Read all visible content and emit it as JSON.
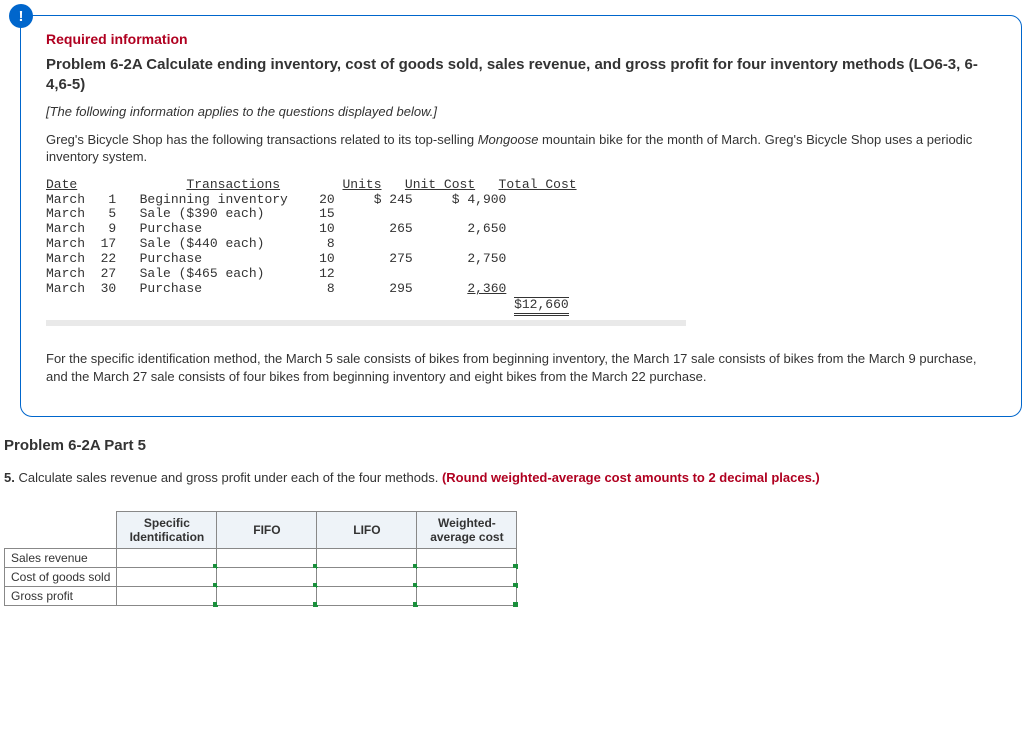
{
  "required_info_label": "Required information",
  "problem_title": "Problem 6-2A Calculate ending inventory, cost of goods sold, sales revenue, and gross profit for four inventory methods (LO6-3, 6-4,6-5)",
  "applies_note": "[The following information applies to the questions displayed below.]",
  "intro_text_1": "Greg's Bicycle Shop has the following transactions related to its top-selling ",
  "intro_text_em": "Mongoose",
  "intro_text_2": " mountain bike for the month of March. Greg's Bicycle Shop uses a periodic inventory system.",
  "trans_table": {
    "headers": {
      "date": "Date",
      "trans": "Transactions",
      "units": "Units",
      "unit_cost": "Unit Cost",
      "total_cost": "Total Cost"
    },
    "rows": [
      {
        "date": "March   1",
        "trans": "Beginning inventory",
        "units": "20",
        "unit_cost": "$ 245",
        "total_cost": "$ 4,900"
      },
      {
        "date": "March   5",
        "trans": "Sale ($390 each)",
        "units": "15",
        "unit_cost": "",
        "total_cost": ""
      },
      {
        "date": "March   9",
        "trans": "Purchase",
        "units": "10",
        "unit_cost": "265",
        "total_cost": "2,650"
      },
      {
        "date": "March  17",
        "trans": "Sale ($440 each)",
        "units": " 8",
        "unit_cost": "",
        "total_cost": ""
      },
      {
        "date": "March  22",
        "trans": "Purchase",
        "units": "10",
        "unit_cost": "275",
        "total_cost": "2,750"
      },
      {
        "date": "March  27",
        "trans": "Sale ($465 each)",
        "units": "12",
        "unit_cost": "",
        "total_cost": ""
      },
      {
        "date": "March  30",
        "trans": "Purchase",
        "units": " 8",
        "unit_cost": "295",
        "total_cost": "2,360"
      }
    ],
    "total": "$12,660"
  },
  "spec_id_note": "For the specific identification method, the March 5 sale consists of bikes from beginning inventory, the March 17 sale consists of bikes from the March 9 purchase, and the March 27 sale consists of four bikes from beginning inventory and eight bikes from the March 22 purchase.",
  "part_title": "Problem 6-2A Part 5",
  "question_num": "5.",
  "question_text": " Calculate sales revenue and gross profit under each of the four methods. ",
  "question_red": "(Round weighted-average cost amounts to 2 decimal places.)",
  "answer_grid": {
    "columns": [
      "Specific Identification",
      "FIFO",
      "LIFO",
      "Weighted-average cost"
    ],
    "rows": [
      "Sales revenue",
      "Cost of goods sold",
      "Gross profit"
    ]
  },
  "chart_data": {
    "type": "table",
    "title": "March transactions — Mongoose mountain bike (periodic inventory)",
    "columns": [
      "Date",
      "Transactions",
      "Units",
      "Unit Cost",
      "Total Cost"
    ],
    "rows": [
      [
        "March 1",
        "Beginning inventory",
        20,
        245,
        4900
      ],
      [
        "March 5",
        "Sale ($390 each)",
        15,
        null,
        null
      ],
      [
        "March 9",
        "Purchase",
        10,
        265,
        2650
      ],
      [
        "March 17",
        "Sale ($440 each)",
        8,
        null,
        null
      ],
      [
        "March 22",
        "Purchase",
        10,
        275,
        2750
      ],
      [
        "March 27",
        "Sale ($465 each)",
        12,
        null,
        null
      ],
      [
        "March 30",
        "Purchase",
        8,
        295,
        2360
      ]
    ],
    "total_cost": 12660
  }
}
